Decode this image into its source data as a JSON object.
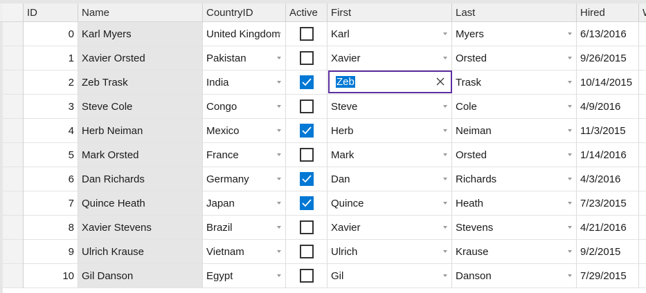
{
  "columns": {
    "id": "ID",
    "name": "Name",
    "country": "CountryID",
    "active": "Active",
    "first": "First",
    "last": "Last",
    "hired": "Hired",
    "extra": "W"
  },
  "rows": [
    {
      "id": "0",
      "name": "Karl Myers",
      "country": "United Kingdom",
      "active": false,
      "first": "Karl",
      "last": "Myers",
      "hired": "6/13/2016"
    },
    {
      "id": "1",
      "name": "Xavier Orsted",
      "country": "Pakistan",
      "active": false,
      "first": "Xavier",
      "last": "Orsted",
      "hired": "9/26/2015"
    },
    {
      "id": "2",
      "name": "Zeb Trask",
      "country": "India",
      "active": true,
      "first": "",
      "last": "Trask",
      "hired": "10/14/2015"
    },
    {
      "id": "3",
      "name": "Steve Cole",
      "country": "Congo",
      "active": false,
      "first": "Steve",
      "last": "Cole",
      "hired": "4/9/2016"
    },
    {
      "id": "4",
      "name": "Herb Neiman",
      "country": "Mexico",
      "active": true,
      "first": "Herb",
      "last": "Neiman",
      "hired": "11/3/2015"
    },
    {
      "id": "5",
      "name": "Mark Orsted",
      "country": "France",
      "active": false,
      "first": "Mark",
      "last": "Orsted",
      "hired": "1/14/2016"
    },
    {
      "id": "6",
      "name": "Dan Richards",
      "country": "Germany",
      "active": true,
      "first": "Dan",
      "last": "Richards",
      "hired": "4/3/2016"
    },
    {
      "id": "7",
      "name": "Quince Heath",
      "country": "Japan",
      "active": true,
      "first": "Quince",
      "last": "Heath",
      "hired": "7/23/2015"
    },
    {
      "id": "8",
      "name": "Xavier Stevens",
      "country": "Brazil",
      "active": false,
      "first": "Xavier",
      "last": "Stevens",
      "hired": "4/21/2016"
    },
    {
      "id": "9",
      "name": "Ulrich Krause",
      "country": "Vietnam",
      "active": false,
      "first": "Ulrich",
      "last": "Krause",
      "hired": "9/2/2015"
    },
    {
      "id": "10",
      "name": "Gil Danson",
      "country": "Egypt",
      "active": false,
      "first": "Gil",
      "last": "Danson",
      "hired": "7/29/2015"
    }
  ],
  "editor": {
    "row_index": 2,
    "value": "Zeb"
  },
  "colors": {
    "accent": "#0078d4",
    "editor_border": "#5b2fa0",
    "readonly_cell": "#e6e6e6"
  }
}
